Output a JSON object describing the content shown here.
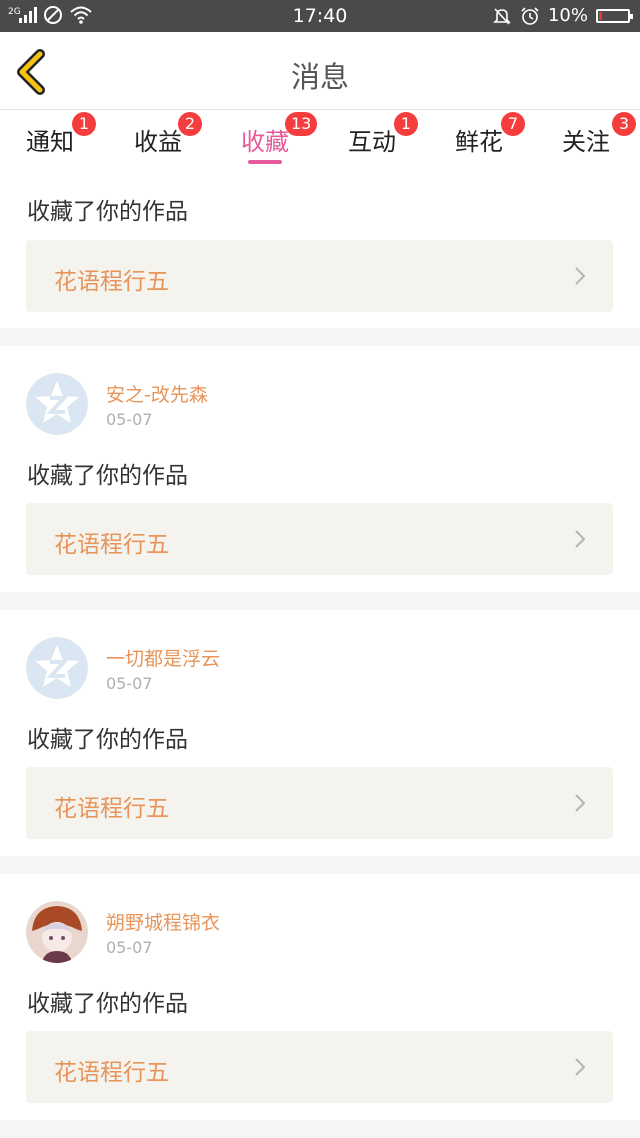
{
  "status_bar": {
    "network": "2G",
    "time": "17:40",
    "battery": "10%",
    "battery_level": 0.1
  },
  "header": {
    "title": "消息"
  },
  "tabs": [
    {
      "label": "通知",
      "badge": "1"
    },
    {
      "label": "收益",
      "badge": "2"
    },
    {
      "label": "收藏",
      "badge": "13",
      "active": true
    },
    {
      "label": "互动",
      "badge": "1"
    },
    {
      "label": "鲜花",
      "badge": "7"
    },
    {
      "label": "关注",
      "badge": "3"
    }
  ],
  "messages": [
    {
      "user": "",
      "date": "",
      "action": "收藏了你的作品",
      "work": "花语程行五"
    },
    {
      "user": "安之-改先森",
      "date": "05-07",
      "action": "收藏了你的作品",
      "work": "花语程行五"
    },
    {
      "user": "一切都是浮云",
      "date": "05-07",
      "action": "收藏了你的作品",
      "work": "花语程行五"
    },
    {
      "user": "朔野城程锦衣",
      "date": "05-07",
      "action": "收藏了你的作品",
      "work": "花语程行五"
    }
  ],
  "colors": {
    "accent": "#e55b9a",
    "badge": "#f53d3d",
    "username": "#e8945a",
    "work_title": "#e8945a",
    "back_arrow": "#f3c316"
  },
  "icons": {
    "back": "back-chevron-icon",
    "chevron": "chevron-right-icon",
    "default_avatar": "default-avatar-icon"
  }
}
